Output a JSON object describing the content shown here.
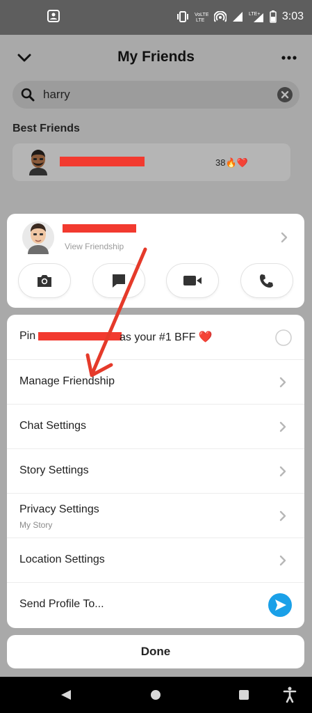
{
  "status_bar": {
    "time": "3:03",
    "icons": [
      "contact-card-icon",
      "vibrate-icon",
      "volte-icon",
      "hotspot-icon",
      "signal-icon",
      "lte-signal-icon",
      "battery-icon"
    ]
  },
  "header": {
    "title": "My Friends"
  },
  "search": {
    "value": "harry",
    "placeholder": ""
  },
  "best_friends": {
    "section_label": "Best Friends",
    "row": {
      "streak": "38🔥❤️"
    }
  },
  "friend_card": {
    "subtitle": "View Friendship",
    "actions": [
      "camera",
      "chat",
      "video-call",
      "voice-call"
    ]
  },
  "options": [
    {
      "label_prefix": "Pin",
      "label_suffix": "as your #1 BFF ❤️",
      "control": "radio"
    },
    {
      "label": "Manage Friendship",
      "control": "chevron"
    },
    {
      "label": "Chat Settings",
      "control": "chevron"
    },
    {
      "label": "Story Settings",
      "control": "chevron"
    },
    {
      "label": "Privacy Settings",
      "sublabel": "My Story",
      "control": "chevron"
    },
    {
      "label": "Location Settings",
      "control": "chevron"
    },
    {
      "label": "Send Profile To...",
      "control": "send"
    }
  ],
  "done_label": "Done",
  "colors": {
    "redaction": "#f23a2f",
    "send_blue": "#1aa0e8",
    "annotation_arrow": "#e53a2a"
  }
}
